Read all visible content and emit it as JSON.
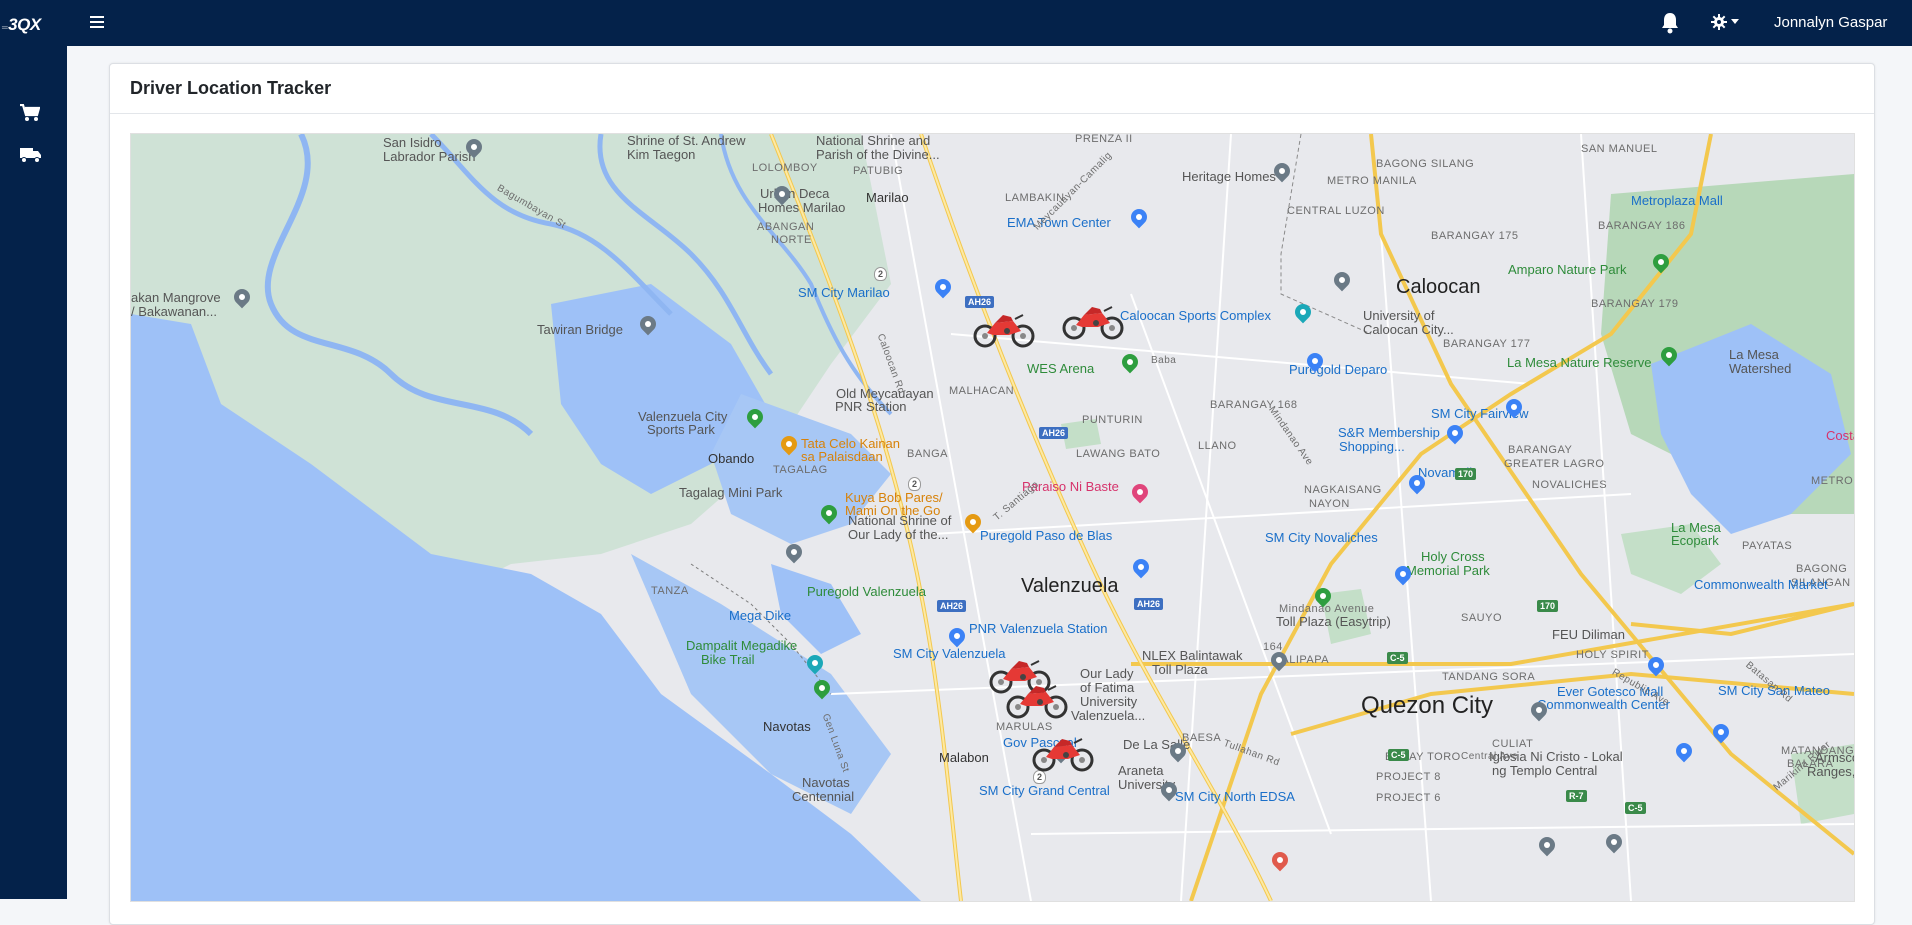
{
  "app": {
    "logo_text": "3QX",
    "logo_prefix": "═",
    "user_name": "Jonnalyn Gaspar"
  },
  "colors": {
    "navbar": "#04224a",
    "sidebar": "#04224a",
    "water": "#9ec1f7",
    "park": "#cfe2d6",
    "road_major": "#f8d46b"
  },
  "icons": {
    "menu": "hamburger-icon",
    "notifications": "bell-icon",
    "settings": "gear-icon",
    "cart": "cart-icon",
    "truck": "truck-icon",
    "driver": "motorcycle-icon"
  },
  "sidebar": {
    "items": [
      {
        "icon": "cart-icon"
      },
      {
        "icon": "truck-icon"
      }
    ]
  },
  "page": {
    "title": "Driver Location Tracker"
  },
  "map": {
    "labels": [
      {
        "text": "San Isidro"
      },
      {
        "text": "Labrador Parish"
      },
      {
        "text": "Shrine of St. Andrew"
      },
      {
        "text": "Kim Taegon"
      },
      {
        "text": "National Shrine and"
      },
      {
        "text": "Parish of the Divine..."
      },
      {
        "text": "PRENZA II"
      },
      {
        "text": "LOLOMBOY"
      },
      {
        "text": "PATUBIG"
      },
      {
        "text": "Urban Deca"
      },
      {
        "text": "Homes Marilao"
      },
      {
        "text": "ABANGAN"
      },
      {
        "text": "NORTE"
      },
      {
        "text": "Marilao"
      },
      {
        "text": "LAMBAKIN"
      },
      {
        "text": "Heritage Homes"
      },
      {
        "text": "EMA Town Center"
      },
      {
        "text": "CENTRAL LUZON"
      },
      {
        "text": "METRO MANILA"
      },
      {
        "text": "BAGONG SILANG"
      },
      {
        "text": "SAN MANUEL"
      },
      {
        "text": "Metroplaza Mall"
      },
      {
        "text": "BARANGAY 186"
      },
      {
        "text": "BARANGAY 175"
      },
      {
        "text": "akan Mangrove"
      },
      {
        "text": "/ Bakawanan..."
      },
      {
        "text": "Tawiran Bridge"
      },
      {
        "text": "SM City Marilao"
      },
      {
        "text": "Caloocan"
      },
      {
        "text": "University of"
      },
      {
        "text": "Caloocan City..."
      },
      {
        "text": "Amparo Nature Park"
      },
      {
        "text": "BARANGAY 179"
      },
      {
        "text": "BARANGAY 177"
      },
      {
        "text": "La Mesa Nature Reserve"
      },
      {
        "text": "La Mesa"
      },
      {
        "text": "Watershed"
      },
      {
        "text": "Caloocan Sports Complex"
      },
      {
        "text": "WES Arena"
      },
      {
        "text": "Puregold Deparo"
      },
      {
        "text": "MALHACAN"
      },
      {
        "text": "Old Meycauayan"
      },
      {
        "text": "PNR Station"
      },
      {
        "text": "BARANGAY 168"
      },
      {
        "text": "SM City Fairview"
      },
      {
        "text": "S&R Membership"
      },
      {
        "text": "Shopping..."
      },
      {
        "text": "PUNTURIN"
      },
      {
        "text": "Valenzuela City"
      },
      {
        "text": "Sports Park"
      },
      {
        "text": "Tata Celo Kainan"
      },
      {
        "text": "sa Palaisdaan"
      },
      {
        "text": "BANGA"
      },
      {
        "text": "LAWANG BATO"
      },
      {
        "text": "LLANO"
      },
      {
        "text": "BARANGAY"
      },
      {
        "text": "GREATER LAGRO"
      },
      {
        "text": "Obando"
      },
      {
        "text": "TAGALAG"
      },
      {
        "text": "Novamall"
      },
      {
        "text": "NOVALICHES"
      },
      {
        "text": "Paraiso Ni Baste"
      },
      {
        "text": "Tagalag Mini Park"
      },
      {
        "text": "Kuya Bob Pares/"
      },
      {
        "text": "Mami On the Go"
      },
      {
        "text": "NAGKAISANG"
      },
      {
        "text": "NAYON"
      },
      {
        "text": "National Shrine of"
      },
      {
        "text": "Our Lady of the..."
      },
      {
        "text": "Puregold Paso de Blas"
      },
      {
        "text": "SM City Novaliches"
      },
      {
        "text": "La Mesa"
      },
      {
        "text": "Ecopark"
      },
      {
        "text": "PAYATAS"
      },
      {
        "text": "Holy Cross"
      },
      {
        "text": "Memorial Park"
      },
      {
        "text": "BAGONG"
      },
      {
        "text": "SILANGAN"
      },
      {
        "text": "TANZA"
      },
      {
        "text": "Puregold Valenzuela"
      },
      {
        "text": "Valenzuela"
      },
      {
        "text": "Commonwealth Market"
      },
      {
        "text": "Mega Dike"
      },
      {
        "text": "PNR Valenzuela Station"
      },
      {
        "text": "Mindanao Avenue"
      },
      {
        "text": "Toll Plaza (Easytrip)"
      },
      {
        "text": "SAUYO"
      },
      {
        "text": "Dampalit Megadike"
      },
      {
        "text": "Bike Trail"
      },
      {
        "text": "SM City Valenzuela"
      },
      {
        "text": "NLEX Balintawak"
      },
      {
        "text": "Toll Plaza"
      },
      {
        "text": "164"
      },
      {
        "text": "FEU Diliman"
      },
      {
        "text": "HOLY SPIRIT"
      },
      {
        "text": "TALIPAPA"
      },
      {
        "text": "Our Lady"
      },
      {
        "text": "of Fatima"
      },
      {
        "text": "University"
      },
      {
        "text": "Valenzuela..."
      },
      {
        "text": "TANDANG SORA"
      },
      {
        "text": "Ever Gotesco Mall"
      },
      {
        "text": "Commonwealth Center"
      },
      {
        "text": "SM City San Mateo"
      },
      {
        "text": "Navotas"
      },
      {
        "text": "MARULAS"
      },
      {
        "text": "Quezon City"
      },
      {
        "text": "BAESA"
      },
      {
        "text": "CULIAT"
      },
      {
        "text": "Armsco"
      },
      {
        "text": "Ranges, In"
      },
      {
        "text": "Gov Pascual"
      },
      {
        "text": "De La Salle"
      },
      {
        "text": "Araneta"
      },
      {
        "text": "University"
      },
      {
        "text": "BAHAY TORO"
      },
      {
        "text": "Iglesia Ni Cristo - Lokal"
      },
      {
        "text": "ng Templo Central"
      },
      {
        "text": "MATANDANG"
      },
      {
        "text": "BALARA"
      },
      {
        "text": "Malabon"
      },
      {
        "text": "Navotas"
      },
      {
        "text": "Centennial"
      },
      {
        "text": "SM City Grand Central"
      },
      {
        "text": "SM City North EDSA"
      },
      {
        "text": "PROJECT 8"
      },
      {
        "text": "PROJECT 6"
      },
      {
        "text": "Costa"
      },
      {
        "text": "METRO MANILA"
      }
    ],
    "shields": [
      {
        "text": "AH26"
      },
      {
        "text": "AH26"
      },
      {
        "text": "AH26"
      },
      {
        "text": "AH26"
      },
      {
        "text": "2"
      },
      {
        "text": "2"
      },
      {
        "text": "2"
      },
      {
        "text": "170"
      },
      {
        "text": "170"
      },
      {
        "text": "C-5"
      },
      {
        "text": "C-5"
      },
      {
        "text": "R-7"
      },
      {
        "text": "C-5"
      }
    ],
    "roads": [
      {
        "text": "Bagumbayan St"
      },
      {
        "text": "Meycauayan-Camalig"
      },
      {
        "text": "Caloocan Rd"
      },
      {
        "text": "Baba"
      },
      {
        "text": "T. Santiago"
      },
      {
        "text": "Tullahan Rd"
      },
      {
        "text": "Batasan Rd"
      },
      {
        "text": "Gen Luna St"
      },
      {
        "text": "Mindanao Ave"
      },
      {
        "text": "Republic Ave"
      },
      {
        "text": "Central Ave"
      },
      {
        "text": "Marikina River"
      }
    ],
    "drivers": [
      {
        "name": "driver-1"
      },
      {
        "name": "driver-2"
      },
      {
        "name": "driver-3"
      },
      {
        "name": "driver-4"
      },
      {
        "name": "driver-5"
      }
    ]
  }
}
